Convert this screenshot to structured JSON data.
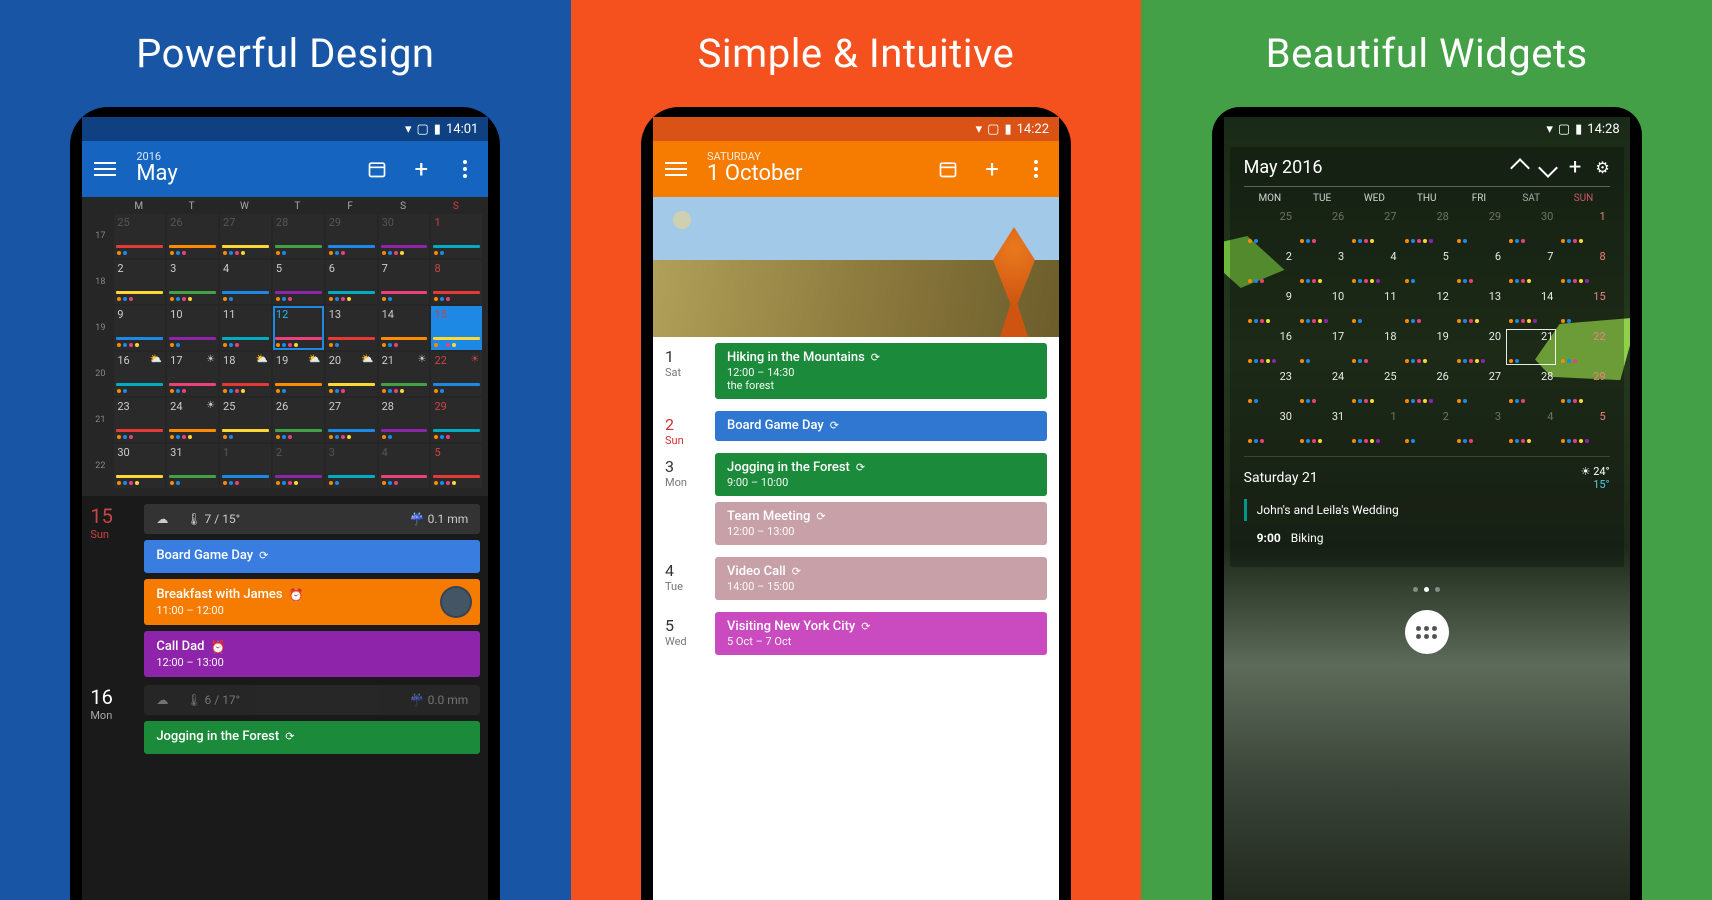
{
  "panels": [
    {
      "title": "Powerful Design"
    },
    {
      "title": "Simple & Intuitive"
    },
    {
      "title": "Beautiful Widgets"
    }
  ],
  "p1": {
    "status_time": "14:01",
    "year": "2016",
    "month": "May",
    "weekdays": [
      "M",
      "T",
      "W",
      "T",
      "F",
      "S",
      "S"
    ],
    "weeks": [
      "17",
      "18",
      "19",
      "20",
      "21",
      "22"
    ],
    "grid": [
      [
        {
          "n": "25",
          "dim": 1
        },
        {
          "n": "26",
          "dim": 1
        },
        {
          "n": "27",
          "dim": 1
        },
        {
          "n": "28",
          "dim": 1
        },
        {
          "n": "29",
          "dim": 1
        },
        {
          "n": "30",
          "dim": 1
        },
        {
          "n": "1",
          "sun": 1
        }
      ],
      [
        {
          "n": "2"
        },
        {
          "n": "3"
        },
        {
          "n": "4"
        },
        {
          "n": "5"
        },
        {
          "n": "6"
        },
        {
          "n": "7"
        },
        {
          "n": "8",
          "sun": 1
        }
      ],
      [
        {
          "n": "9"
        },
        {
          "n": "10"
        },
        {
          "n": "11"
        },
        {
          "n": "12",
          "today": 1
        },
        {
          "n": "13"
        },
        {
          "n": "14"
        },
        {
          "n": "15",
          "sun": 1,
          "sel": 1
        }
      ],
      [
        {
          "n": "16",
          "w": "⛅"
        },
        {
          "n": "17",
          "w": "☀"
        },
        {
          "n": "18",
          "w": "⛅"
        },
        {
          "n": "19",
          "w": "⛅"
        },
        {
          "n": "20",
          "w": "⛅"
        },
        {
          "n": "21",
          "w": "☀"
        },
        {
          "n": "22",
          "sun": 1,
          "w": "☀"
        }
      ],
      [
        {
          "n": "23"
        },
        {
          "n": "24",
          "w": "☀"
        },
        {
          "n": "25"
        },
        {
          "n": "26"
        },
        {
          "n": "27"
        },
        {
          "n": "28"
        },
        {
          "n": "29",
          "sun": 1
        }
      ],
      [
        {
          "n": "30"
        },
        {
          "n": "31"
        },
        {
          "n": "1",
          "dim": 1
        },
        {
          "n": "2",
          "dim": 1
        },
        {
          "n": "3",
          "dim": 1
        },
        {
          "n": "4",
          "dim": 1
        },
        {
          "n": "5",
          "sun": 1,
          "dim": 1
        }
      ]
    ],
    "agenda": [
      {
        "day": "15",
        "wd": "Sun",
        "sun": 1,
        "weather": {
          "temp": "7 / 15°",
          "precip": "0.1 mm"
        },
        "events": [
          {
            "title": "Board Game Day",
            "color": "#3a7de0",
            "sync": 1
          },
          {
            "title": "Breakfast with James",
            "sub": "11:00 – 12:00",
            "color": "#f57c00",
            "alarm": 1,
            "avatar": 1
          },
          {
            "title": "Call Dad",
            "sub": "12:00 – 13:00",
            "color": "#8e24aa",
            "alarm": 1
          }
        ]
      },
      {
        "day": "16",
        "wd": "Mon",
        "weather": {
          "temp": "6 / 17°",
          "precip": "0.0 mm",
          "dim": 1
        },
        "events": [
          {
            "title": "Jogging in the Forest",
            "color": "#1b8a3a",
            "sync": 1
          }
        ]
      }
    ]
  },
  "p2": {
    "status_time": "14:22",
    "weekday": "SATURDAY",
    "date_title": "1 October",
    "days": [
      {
        "n": "1",
        "wd": "Sat",
        "events": [
          {
            "title": "Hiking in the Mountains",
            "sub1": "12:00 – 14:30",
            "sub2": "the forest",
            "color": "#1b8a3a",
            "sync": 1
          }
        ]
      },
      {
        "n": "2",
        "wd": "Sun",
        "sun": 1,
        "events": [
          {
            "title": "Board Game Day",
            "color": "#2f77d0",
            "sync": 1
          }
        ]
      },
      {
        "n": "3",
        "wd": "Mon",
        "events": [
          {
            "title": "Jogging in the Forest",
            "sub1": "9:00 – 10:00",
            "color": "#1b8a3a",
            "sync": 1
          },
          {
            "title": "Team Meeting",
            "sub1": "12:00 – 13:00",
            "color": "#c7a0a8",
            "sync": 1
          }
        ]
      },
      {
        "n": "4",
        "wd": "Tue",
        "events": [
          {
            "title": "Video Call",
            "sub1": "14:00 – 15:00",
            "color": "#c7a0a8",
            "sync": 1
          }
        ]
      },
      {
        "n": "5",
        "wd": "Wed",
        "events": [
          {
            "title": "Visiting New York City",
            "sub1": "5 Oct – 7 Oct",
            "color": "#c94bbf",
            "sync": 1
          }
        ]
      }
    ]
  },
  "p3": {
    "status_time": "14:28",
    "title": "May 2016",
    "weekdays": [
      "MON",
      "TUE",
      "WED",
      "THU",
      "FRI",
      "SAT",
      "SUN"
    ],
    "grid": [
      [
        {
          "n": "25",
          "dim": 1
        },
        {
          "n": "26",
          "dim": 1
        },
        {
          "n": "27",
          "dim": 1
        },
        {
          "n": "28",
          "dim": 1
        },
        {
          "n": "29",
          "dim": 1
        },
        {
          "n": "30",
          "dim": 1
        },
        {
          "n": "1",
          "sun": 1
        }
      ],
      [
        {
          "n": "2"
        },
        {
          "n": "3"
        },
        {
          "n": "4"
        },
        {
          "n": "5"
        },
        {
          "n": "6"
        },
        {
          "n": "7"
        },
        {
          "n": "8",
          "sun": 1
        }
      ],
      [
        {
          "n": "9"
        },
        {
          "n": "10"
        },
        {
          "n": "11"
        },
        {
          "n": "12"
        },
        {
          "n": "13"
        },
        {
          "n": "14"
        },
        {
          "n": "15",
          "sun": 1
        }
      ],
      [
        {
          "n": "16"
        },
        {
          "n": "17"
        },
        {
          "n": "18"
        },
        {
          "n": "19"
        },
        {
          "n": "20"
        },
        {
          "n": "21",
          "sel": 1
        },
        {
          "n": "22",
          "sun": 1
        }
      ],
      [
        {
          "n": "23"
        },
        {
          "n": "24"
        },
        {
          "n": "25"
        },
        {
          "n": "26"
        },
        {
          "n": "27"
        },
        {
          "n": "28"
        },
        {
          "n": "29",
          "sun": 1
        }
      ],
      [
        {
          "n": "30"
        },
        {
          "n": "31"
        },
        {
          "n": "1",
          "dim": 1
        },
        {
          "n": "2",
          "dim": 1
        },
        {
          "n": "3",
          "dim": 1
        },
        {
          "n": "4",
          "dim": 1
        },
        {
          "n": "5",
          "dim": 1,
          "sun": 1
        }
      ]
    ],
    "sel": {
      "label": "Saturday 21",
      "hi": "24°",
      "lo": "15°"
    },
    "events": [
      {
        "title": "John's and Leila's Wedding"
      },
      {
        "time": "9:00",
        "title": "Biking"
      }
    ]
  },
  "colors": {
    "dot_palette": [
      "#e53935",
      "#fb8c00",
      "#fdd835",
      "#43a047",
      "#1e88e5",
      "#8e24aa",
      "#00acc1",
      "#ec407a"
    ]
  }
}
